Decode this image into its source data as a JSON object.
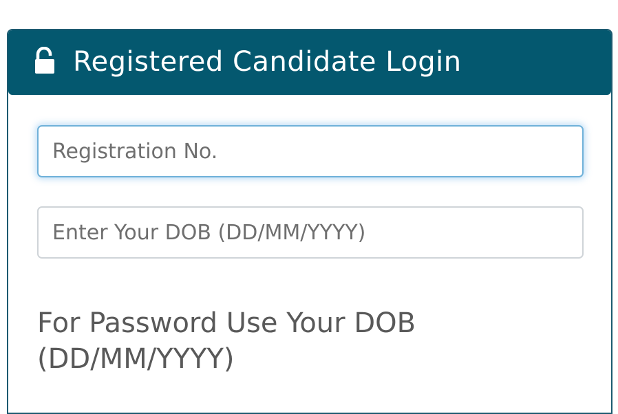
{
  "header": {
    "title": "Registered Candidate Login",
    "icon": "unlocked-lock-icon",
    "background_color": "#04586f"
  },
  "form": {
    "registration_placeholder": "Registration No.",
    "registration_value": "",
    "dob_placeholder": "Enter Your DOB (DD/MM/YYYY)",
    "dob_value": ""
  },
  "hint": {
    "text": "For Password Use Your DOB (DD/MM/YYYY)"
  },
  "colors": {
    "accent": "#04586f",
    "focus_ring": "#6fb1d9"
  }
}
